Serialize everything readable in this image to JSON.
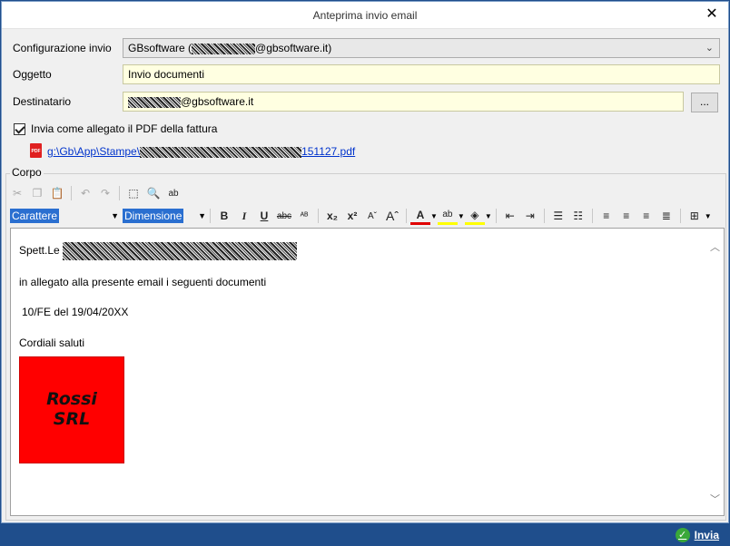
{
  "window": {
    "title": "Anteprima invio email",
    "close_glyph": "✕"
  },
  "form": {
    "config_label": "Configurazione invio",
    "config_value_prefix": "GBsoftware (",
    "config_value_suffix": "@gbsoftware.it)",
    "subject_label": "Oggetto",
    "subject_value": "Invio documenti",
    "recipient_label": "Destinatario",
    "recipient_value_suffix": "@gbsoftware.it",
    "browse_label": "..."
  },
  "attachment": {
    "checkbox_label": "Invia come allegato il PDF della fattura",
    "icon_text": "PDF",
    "path_prefix": "g:\\Gb\\App\\Stampe\\",
    "path_suffix": "151127.pdf"
  },
  "body_group": {
    "title": "Corpo"
  },
  "toolbar": {
    "font_label": "Carattere",
    "size_label": "Dimensione",
    "bold": "B",
    "italic": "I",
    "underline": "U",
    "strike": "abc"
  },
  "editor": {
    "greeting": "Spett.Le",
    "line1": "in allegato alla presente email i seguenti documenti",
    "line2": "10/FE del 19/04/20XX",
    "closing": "Cordiali saluti",
    "logo_line1": "Rossi",
    "logo_line2": "SRL"
  },
  "status": {
    "send_label": "Invia"
  },
  "colors": {
    "accent": "#1f4e8c",
    "logo_bg": "#ff0000",
    "field_yellow": "#ffffe1",
    "link": "#0033cc"
  }
}
